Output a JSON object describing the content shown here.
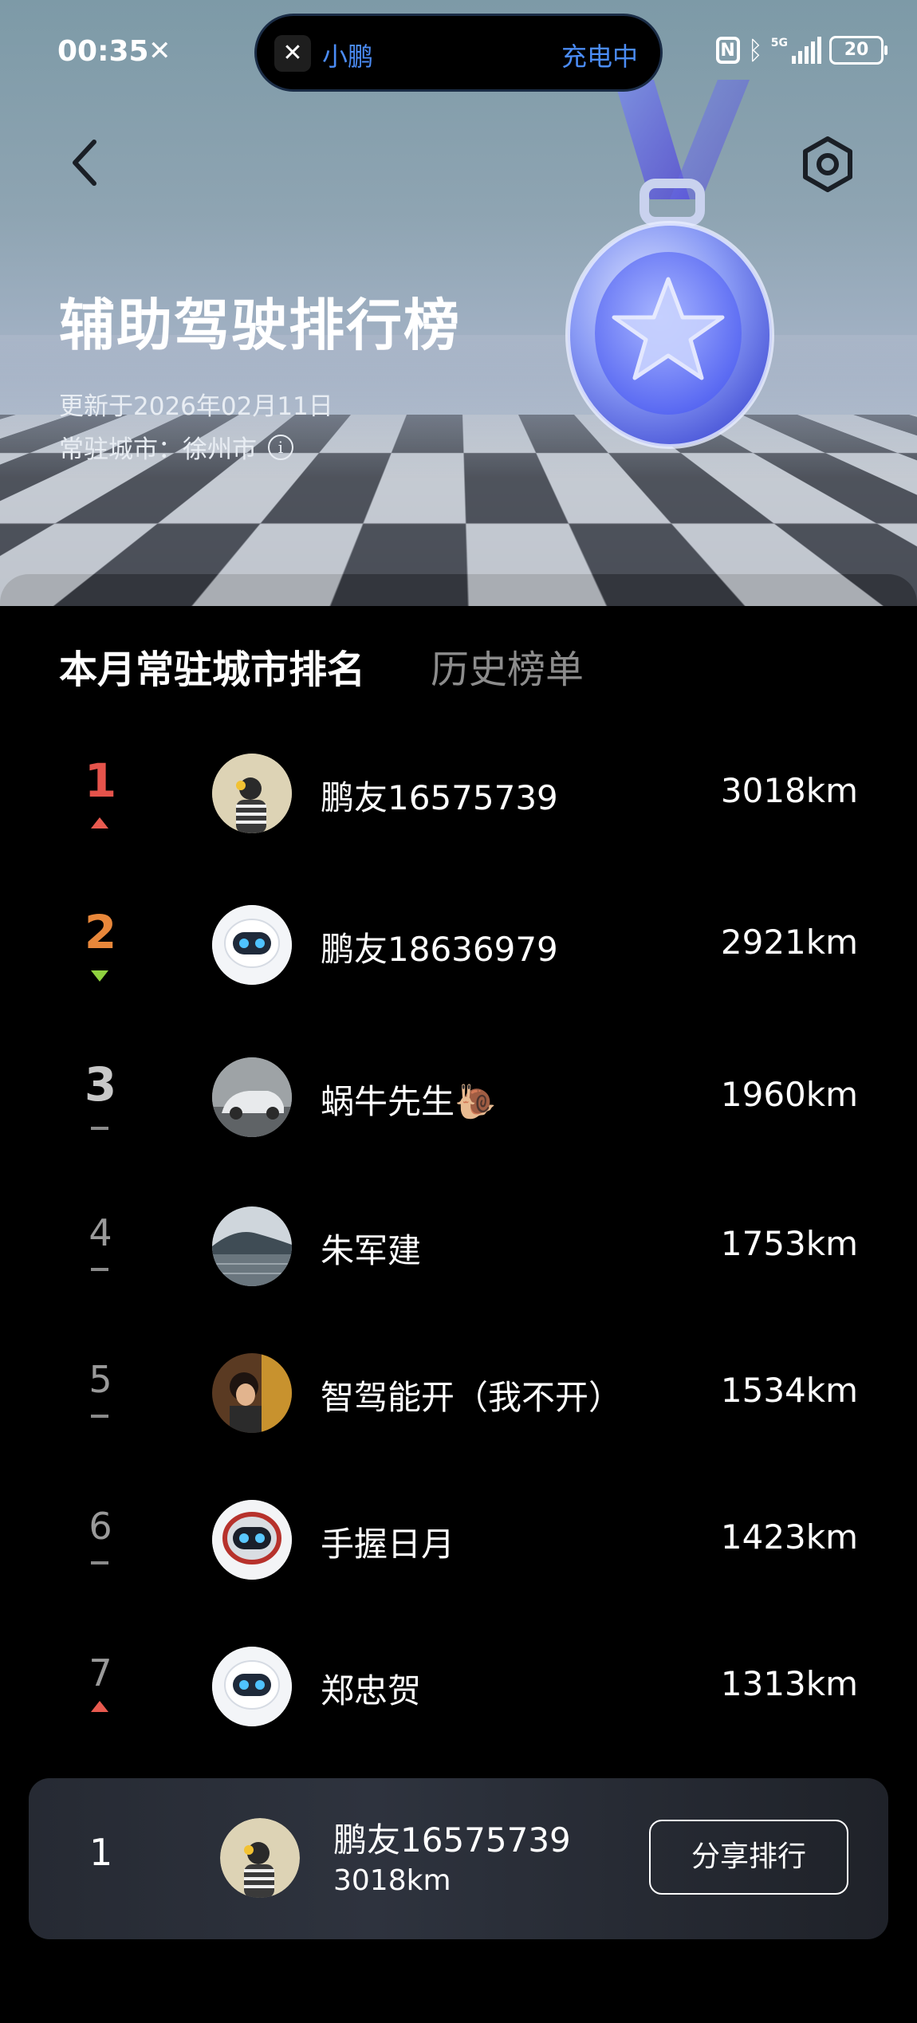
{
  "status_bar": {
    "time": "00:35",
    "time_icon": "bow-tie-logo-icon",
    "island_app": "小鹏",
    "island_status": "充电中",
    "network": "5G",
    "battery": "20"
  },
  "header": {
    "title": "辅助驾驶排行榜",
    "update_text": "更新于2026年02月11日",
    "city_text": "常驻城市：徐州市"
  },
  "tabs": {
    "monthly": "本月常驻城市排名",
    "history": "历史榜单"
  },
  "ranking": [
    {
      "rank": "1",
      "trend": "up",
      "name": "鹏友16575739",
      "distance": "3018km"
    },
    {
      "rank": "2",
      "trend": "down",
      "name": "鹏友18636979",
      "distance": "2921km"
    },
    {
      "rank": "3",
      "trend": "same",
      "name": "蜗牛先生🐌",
      "distance": "1960km"
    },
    {
      "rank": "4",
      "trend": "same",
      "name": "朱军建",
      "distance": "1753km"
    },
    {
      "rank": "5",
      "trend": "same",
      "name": "智驾能开（我不开）",
      "distance": "1534km"
    },
    {
      "rank": "6",
      "trend": "same",
      "name": "手握日月",
      "distance": "1423km"
    },
    {
      "rank": "7",
      "trend": "up",
      "name": "郑忠贺",
      "distance": "1313km"
    }
  ],
  "me": {
    "rank": "1",
    "name": "鹏友16575739",
    "distance": "3018km",
    "share_label": "分享排行"
  },
  "colors": {
    "rank1": "#e5534b",
    "rank2": "#e8873a",
    "rank3": "#c8c8c8",
    "rank_other": "#9a9a9a",
    "trend_up": "#e85a4f",
    "trend_down": "#8fd13f",
    "island_accent": "#4b8cf5"
  }
}
